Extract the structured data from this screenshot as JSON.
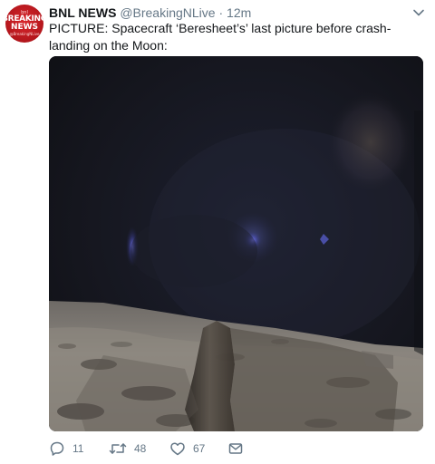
{
  "avatar": {
    "line1": "bnl",
    "line2": "BREAKING",
    "line3": "NEWS",
    "line4": "@BreakingNLive"
  },
  "tweet": {
    "name": "BNL NEWS",
    "handle": "@BreakingNLive",
    "separator": "·",
    "time": "12m",
    "text": "PICTURE: Spacecraft ‘Beresheet’s’ last picture before crash-landing on the Moon:"
  },
  "actions": {
    "reply_count": "11",
    "retweet_count": "48",
    "like_count": "67"
  },
  "icons": {
    "chevron": "chevron-down-icon",
    "reply": "reply-icon",
    "retweet": "retweet-icon",
    "like": "heart-icon",
    "message": "envelope-icon"
  },
  "colors": {
    "text": "#14171a",
    "secondary": "#657786",
    "avatar_red": "#c91c22"
  }
}
